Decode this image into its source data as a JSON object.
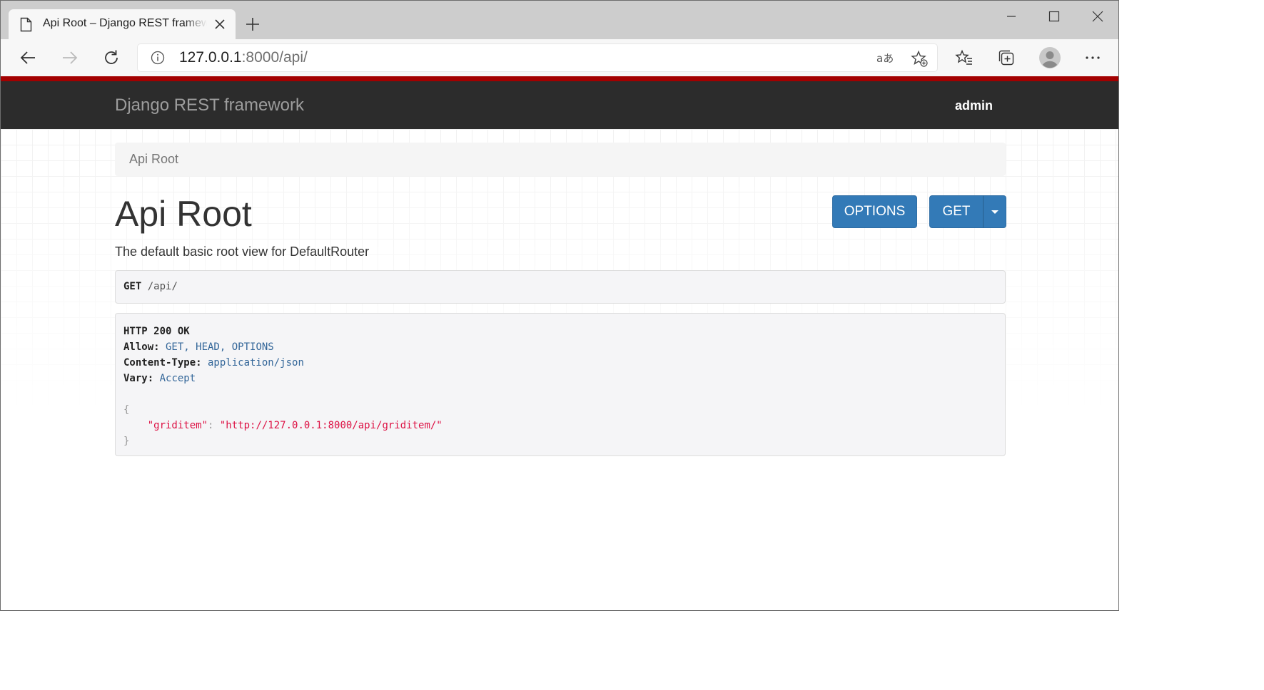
{
  "browser": {
    "tab": {
      "title": "Api Root – Django REST framework"
    },
    "address_bar": {
      "url_host": "127.0.0.1",
      "url_rest": ":8000/api/"
    }
  },
  "navbar": {
    "brand": "Django REST framework",
    "user": "admin"
  },
  "breadcrumb": {
    "items": [
      "Api Root"
    ]
  },
  "content": {
    "title": "Api Root",
    "description": "The default basic root view for DefaultRouter",
    "buttons": {
      "options_label": "OPTIONS",
      "get_label": "GET"
    },
    "request": {
      "method": "GET",
      "path": " /api/"
    },
    "response": {
      "status_line": "HTTP 200 OK",
      "headers": [
        {
          "key": "Allow:",
          "value": " GET, HEAD, OPTIONS"
        },
        {
          "key": "Content-Type:",
          "value": " application/json"
        },
        {
          "key": "Vary:",
          "value": " Accept"
        }
      ],
      "body": {
        "open_brace": "{",
        "entry_key": "\"griditem\"",
        "entry_sep": ": ",
        "entry_value": "\"http://127.0.0.1:8000/api/griditem/\"",
        "close_brace": "}"
      }
    }
  },
  "colors": {
    "brand_stripe": "#a30000",
    "navbar_bg": "#2c2c2c",
    "button_primary": "#337ab7"
  }
}
